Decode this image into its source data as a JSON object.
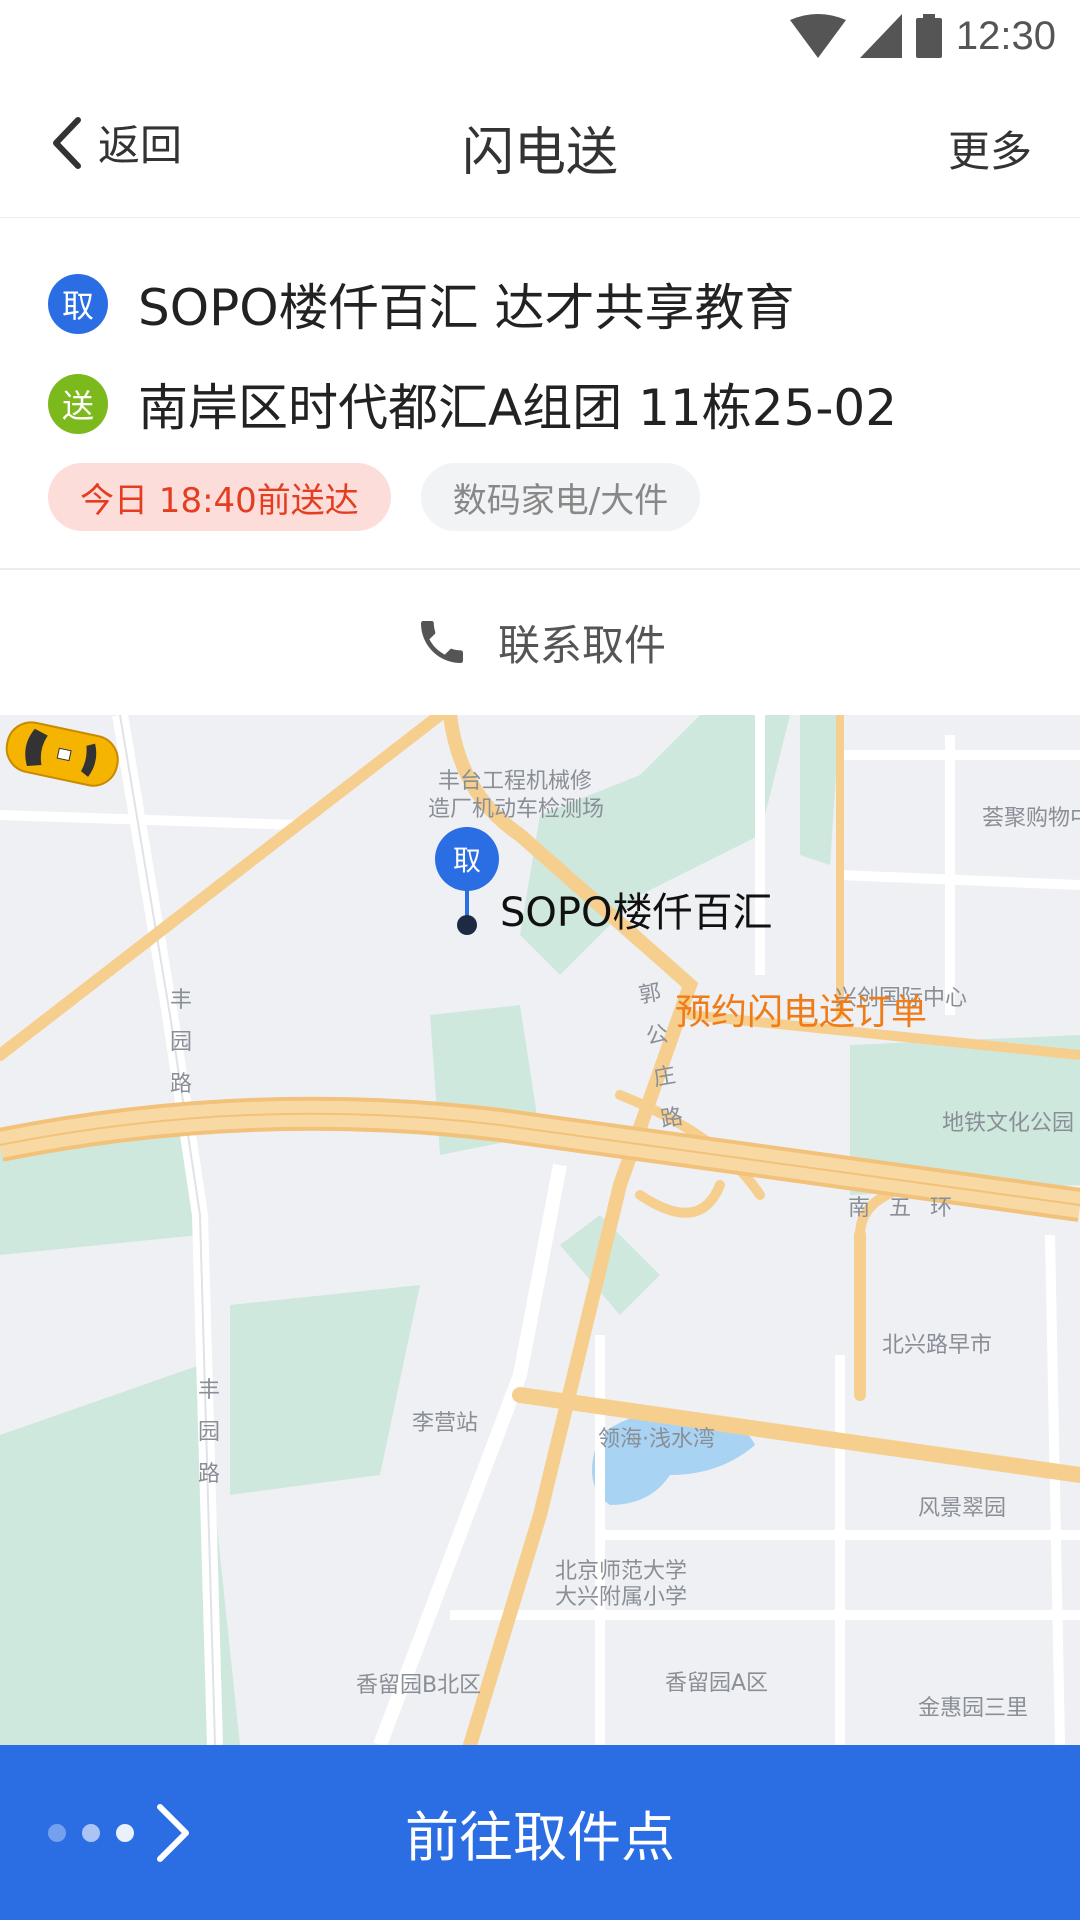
{
  "status_bar": {
    "time": "12:30"
  },
  "header": {
    "back_label": "返回",
    "title": "闪电送",
    "more_label": "更多"
  },
  "pickup": {
    "badge": "取",
    "address": "SOPO楼仟百汇 达才共享教育"
  },
  "delivery": {
    "badge": "送",
    "address": "南岸区时代都汇A组团 11栋25-02"
  },
  "tags": {
    "deadline": "今日 18:40前送达",
    "category": "数码家电/大件"
  },
  "contact": {
    "label": "联系取件"
  },
  "map": {
    "pin_badge": "取",
    "pin_label": "SOPO楼仟百汇",
    "order_label": "预约闪电送订单",
    "labels": {
      "poi_line1": "丰台工程机械修",
      "poi_line2": "造厂机动车检测场",
      "mall": "荟聚购物中",
      "xingchuang": "兴创国际中心",
      "metro_park": "地铁文化公园",
      "ring": "南 五 环",
      "beixinglu": "北兴路早市",
      "liying": "李营站",
      "linghai": "领海·浅水湾",
      "fengjing": "风景翠园",
      "bnu_line1": "北京师范大学",
      "bnu_line2": "大兴附属小学",
      "xiangliu_b": "香留园B北区",
      "xiangliu_a": "香留园A区",
      "jinhui": "金惠园三里",
      "fengyuan_1": "丰园路",
      "fengyuan_2": "丰园路",
      "guogongzhuang": "郭公庄路"
    }
  },
  "bottom_bar": {
    "label": "前往取件点"
  },
  "colors": {
    "primary": "#2b6ee3",
    "send_green": "#7bb91d",
    "deadline_red": "#e43d20",
    "order_orange": "#f07c17",
    "road": "#f6cf8f",
    "green_area": "#cfe8dd"
  }
}
